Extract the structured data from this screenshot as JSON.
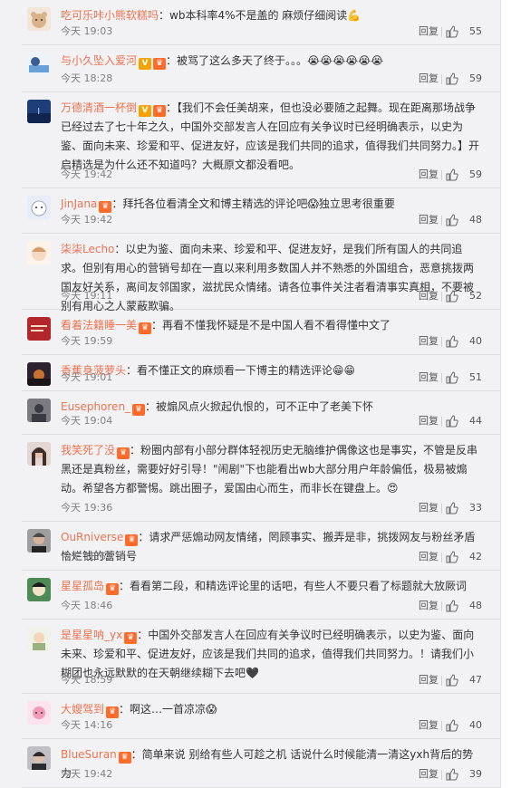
{
  "reply_label": "回复",
  "comments": [
    {
      "user": "吃可乐咔小熊软糕吗",
      "badges": [],
      "text": "：wb本科率4%不是盖的 麻烦仔细阅读",
      "emoji": "💪",
      "time": "今天 19:03",
      "likes": "55",
      "avatar": "bear",
      "avatar_color": "#d9b28a"
    },
    {
      "user": "与小久坠入爱河",
      "badges": [
        "V",
        "vip"
      ],
      "text": "：被骂了这么多天了终于。。。",
      "emoji": "😭😭😭😭😭😭",
      "time": "今天 18:28",
      "likes": "59",
      "avatar": "anime-blue",
      "avatar_color": "#6aa0d8"
    },
    {
      "user": "万德清酒一杯倒",
      "badges": [
        "V",
        "vip"
      ],
      "text": "：【我们不会任美胡来，但也没必要随之起舞。现在距离那场战争已经过去了七十年之久，中国外交部发言人在回应有关争议时已经明确表示，以史为鉴、面向未来、珍爱和平、促进友好，应该是我们共同的追求，值得我们共同努力。】开启精选是为什么还不知道吗？大概原文都没看吧。",
      "emoji": "",
      "time": "今天 19:42",
      "likes": "59",
      "avatar": "sea",
      "avatar_color": "#1e3e7a"
    },
    {
      "user": "JinJana",
      "badges": [
        "vip"
      ],
      "text": "：拜托各位看清全文和博主精选的评论吧😱独立思考很重要",
      "emoji": "",
      "time": "今天 19:42",
      "likes": "48",
      "avatar": "cartoon-white",
      "avatar_color": "#e8eef8"
    },
    {
      "user": "柒柒Lecho",
      "badges": [],
      "text": "：以史为鉴、面向未来、珍爱和平、促进友好，是我们所有国人的共同追求。但别有用心的营销号却在一直以来利用多数国人并不熟悉的外国组合，恶意挑拨两国友好关系，离间友邻国家，滋扰民众情绪。请各位事件关注者看清事实真相，不要被别有用心之人蒙蔽欺骗。",
      "emoji": "",
      "time": "今天 19:11",
      "likes": "52",
      "avatar": "cartoon-girl",
      "avatar_color": "#f6d9c3"
    },
    {
      "user": "看着法籍睡一美",
      "badges": [
        "vip"
      ],
      "text": "：再看不懂我怀疑是不是中国人看不看得懂中文了",
      "emoji": "",
      "time": "今天 19:59",
      "likes": "40",
      "avatar": "text-red",
      "avatar_color": "#b3262b"
    },
    {
      "user": "香蕉身菠萝头",
      "badges": [],
      "text": "：看不懂正文的麻烦看一下博主的精选评论",
      "emoji": "😁😁",
      "time": "今天 19:01",
      "likes": "51",
      "avatar": "sunset",
      "avatar_color": "#c7722e"
    },
    {
      "user": "Eusephoren_",
      "badges": [
        "vip"
      ],
      "text": "：被煽风点火掀起仇恨的，可不正中了老美下怀",
      "emoji": "",
      "time": "今天 19:04",
      "likes": "44",
      "avatar": "dark",
      "avatar_color": "#3a3a44"
    },
    {
      "user": "我笑死了没",
      "badges": [
        "vip"
      ],
      "text": "：粉圈内部有小部分群体轻视历史无脑维护偶像这也是事实，不管是反串黑还是真粉丝，需要好好引导！\"闹剧\"下也能看出wb大部分用户年龄偏低，极易被煽动。希望各方都警惕。跳出圈子，爱国由心而生，而非长在键盘上。",
      "emoji": "😍",
      "time": "今天 19:36",
      "likes": "33",
      "avatar": "photo-girl",
      "avatar_color": "#3f2e2a"
    },
    {
      "user": "OuRniverse",
      "badges": [
        "vip"
      ],
      "text": "：请求严惩煽动网友情绪，罔顾事实、搬弄是非，挑拨网友与粉丝矛盾恰烂钱的营销号",
      "emoji": "",
      "time": "今天 18:53",
      "likes": "42",
      "avatar": "photo-man",
      "avatar_color": "#4a4a4a"
    },
    {
      "user": "星星孤岛",
      "badges": [
        "vip"
      ],
      "text": "：看看第二段，和精选评论里的话吧，有些人不要只看了标题就大放厥词",
      "emoji": "",
      "time": "今天 18:46",
      "likes": "48",
      "avatar": "anime-green",
      "avatar_color": "#4d8a55"
    },
    {
      "user": "是星星呐_yx",
      "badges": [
        "vip"
      ],
      "text": "：中国外交部发言人在回应有关争议时已经明确表示，以史为鉴、面向未来、珍爱和平、促进友好，应该是我们共同的追求，值得我们共同努力。！请我们小糊团也永远默默的在天朝继续糊下去吧",
      "emoji": "🖤",
      "time": "今天 18:59",
      "likes": "47",
      "avatar": "cartoon-kid",
      "avatar_color": "#9ab37e"
    },
    {
      "user": "大嫂驾到",
      "badges": [
        "vip"
      ],
      "text": "：啊这…一首凉凉",
      "emoji": "😱",
      "time": "今天 14:16",
      "likes": "40",
      "avatar": "pink",
      "avatar_color": "#f19ab8"
    },
    {
      "user": "BlueSuran",
      "badges": [
        "vip"
      ],
      "text": "：简单来说 别给有些人可趁之机 话说什么时候能清一清这yxh背后的势力",
      "emoji": "",
      "time": "今天 19:42",
      "likes": "39",
      "avatar": "photo-dark",
      "avatar_color": "#2b2b30"
    }
  ]
}
